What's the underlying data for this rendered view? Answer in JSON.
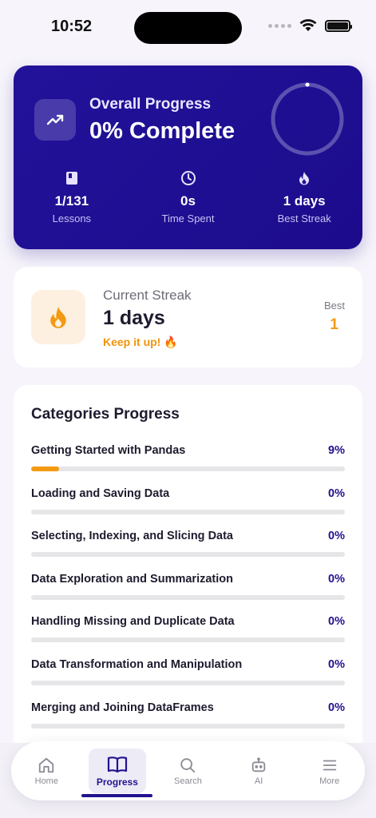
{
  "status_bar": {
    "time": "10:52"
  },
  "overall": {
    "label": "Overall Progress",
    "value": "0% Complete",
    "progress_fraction": 0.0,
    "stats": [
      {
        "icon": "book-icon",
        "value": "1/131",
        "label": "Lessons"
      },
      {
        "icon": "clock-icon",
        "value": "0s",
        "label": "Time Spent"
      },
      {
        "icon": "flame-icon",
        "value": "1 days",
        "label": "Best Streak"
      }
    ]
  },
  "streak": {
    "label": "Current Streak",
    "value": "1 days",
    "message": "Keep it up! 🔥",
    "best_label": "Best",
    "best_value": "1"
  },
  "categories": {
    "title": "Categories Progress",
    "items": [
      {
        "name": "Getting Started with Pandas",
        "percent": "9%",
        "fraction": 0.09
      },
      {
        "name": "Loading and Saving Data",
        "percent": "0%",
        "fraction": 0
      },
      {
        "name": "Selecting, Indexing, and Slicing Data",
        "percent": "0%",
        "fraction": 0
      },
      {
        "name": "Data Exploration and Summarization",
        "percent": "0%",
        "fraction": 0
      },
      {
        "name": "Handling Missing and Duplicate Data",
        "percent": "0%",
        "fraction": 0
      },
      {
        "name": "Data Transformation and Manipulation",
        "percent": "0%",
        "fraction": 0
      },
      {
        "name": "Merging and Joining DataFrames",
        "percent": "0%",
        "fraction": 0
      }
    ]
  },
  "nav": {
    "items": [
      {
        "label": "Home",
        "icon": "home-icon"
      },
      {
        "label": "Progress",
        "icon": "book-open-icon",
        "active": true
      },
      {
        "label": "Search",
        "icon": "search-icon"
      },
      {
        "label": "AI",
        "icon": "robot-icon"
      },
      {
        "label": "More",
        "icon": "menu-icon"
      }
    ]
  },
  "colors": {
    "primary": "#23128f",
    "accent": "#f39a12",
    "background": "#f7f5fb"
  }
}
